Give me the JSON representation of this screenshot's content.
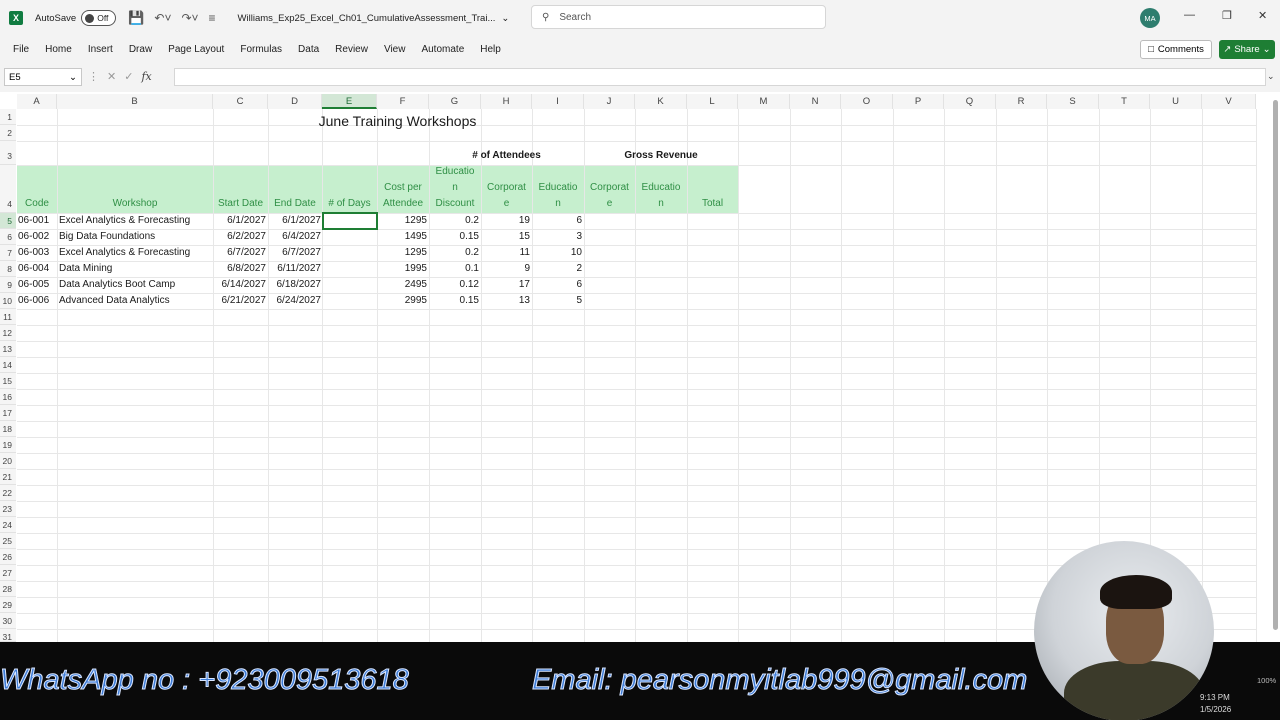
{
  "titlebar": {
    "app_logo": "X",
    "autosave_label": "AutoSave",
    "autosave_state": "Off",
    "filename": "Williams_Exp25_Excel_Ch01_CumulativeAssessment_Trai...",
    "search_placeholder": "Search",
    "avatar_initials": "MA"
  },
  "ribbon": {
    "tabs": [
      "File",
      "Home",
      "Insert",
      "Draw",
      "Page Layout",
      "Formulas",
      "Data",
      "Review",
      "View",
      "Automate",
      "Help"
    ],
    "comments_label": "Comments",
    "share_label": "Share"
  },
  "formula_bar": {
    "name_box": "E5",
    "fx": "fx",
    "formula": ""
  },
  "columns": [
    "A",
    "B",
    "C",
    "D",
    "E",
    "F",
    "G",
    "H",
    "I",
    "J",
    "K",
    "L",
    "M",
    "N",
    "O",
    "P",
    "Q",
    "R",
    "S",
    "T",
    "U",
    "V"
  ],
  "rows": [
    "1",
    "2",
    "3",
    "4",
    "5",
    "6",
    "7",
    "8",
    "9",
    "10",
    "11",
    "12",
    "13",
    "14",
    "15",
    "16",
    "17",
    "18",
    "19",
    "20",
    "21",
    "22",
    "23",
    "24",
    "25",
    "26",
    "27",
    "28",
    "29",
    "30",
    "31"
  ],
  "sheet": {
    "title": "June Training Workshops",
    "group_attendees": "# of Attendees",
    "group_revenue": "Gross Revenue",
    "headers": {
      "code": "Code",
      "workshop": "Workshop",
      "start": "Start Date",
      "end": "End Date",
      "days": "# of Days",
      "cost_l1": "Cost per",
      "cost_l2": "Attendee",
      "disc_l1": "Educatio",
      "disc_l2": "n",
      "disc_l3": "Discount",
      "corp_l1": "Corporat",
      "corp_l2": "e",
      "edu_l1": "Educatio",
      "edu_l2": "n",
      "rcorp_l1": "Corporat",
      "rcorp_l2": "e",
      "redu_l1": "Educatio",
      "redu_l2": "n",
      "total": "Total"
    },
    "data_rows": [
      {
        "code": "06-001",
        "workshop": "Excel Analytics & Forecasting",
        "start": "6/1/2027",
        "end": "6/1/2027",
        "cost": "1295",
        "discount": "0.2",
        "corp": "19",
        "edu": "6"
      },
      {
        "code": "06-002",
        "workshop": "Big Data Foundations",
        "start": "6/2/2027",
        "end": "6/4/2027",
        "cost": "1495",
        "discount": "0.15",
        "corp": "15",
        "edu": "3"
      },
      {
        "code": "06-003",
        "workshop": "Excel Analytics & Forecasting",
        "start": "6/7/2027",
        "end": "6/7/2027",
        "cost": "1295",
        "discount": "0.2",
        "corp": "11",
        "edu": "10"
      },
      {
        "code": "06-004",
        "workshop": "Data Mining",
        "start": "6/8/2027",
        "end": "6/11/2027",
        "cost": "1995",
        "discount": "0.1",
        "corp": "9",
        "edu": "2"
      },
      {
        "code": "06-005",
        "workshop": "Data Analytics Boot Camp",
        "start": "6/14/2027",
        "end": "6/18/2027",
        "cost": "2495",
        "discount": "0.12",
        "corp": "17",
        "edu": "6"
      },
      {
        "code": "06-006",
        "workshop": "Advanced Data Analytics",
        "start": "6/21/2027",
        "end": "6/24/2027",
        "cost": "2995",
        "discount": "0.15",
        "corp": "13",
        "edu": "5"
      }
    ]
  },
  "overlay": {
    "whatsapp": "WhatsApp no : +923009513618",
    "email": "Email: pearsonmyitlab999@gmail.com",
    "time": "9:13 PM",
    "date": "1/5/2026",
    "zoom": "100%"
  },
  "colors": {
    "accent": "#1e7e34",
    "header_fill": "#c6efce",
    "header_text": "#2f8f45"
  }
}
